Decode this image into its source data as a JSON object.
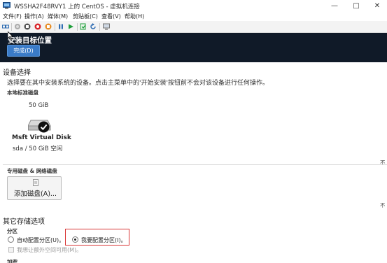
{
  "window": {
    "title": "WSSHA2F48RVY1 上的 CentOS - 虚拟机连接",
    "minimize_glyph": "—",
    "maximize_glyph": "□",
    "close_glyph": "✕"
  },
  "menu": {
    "items": [
      {
        "label": "文件(F)"
      },
      {
        "label": "操作(A)"
      },
      {
        "label": "媒体(M)"
      },
      {
        "label": "剪贴板(C)"
      },
      {
        "label": "查看(V)"
      },
      {
        "label": "帮助(H)"
      }
    ]
  },
  "toolbar": {
    "icons": [
      "ctrl-alt-del-icon",
      "start-icon",
      "turn-off-icon",
      "shut-down-icon",
      "save-icon",
      "pause-icon",
      "resume-icon",
      "checkpoint-icon",
      "revert-icon",
      "enhanced-session-icon"
    ]
  },
  "header": {
    "title": "安装目标位置",
    "done_label": "完成(D)",
    "background": "#101a28",
    "accent": "#3a7bc8"
  },
  "device_selection": {
    "heading": "设备选择",
    "description": "选择要在其中安装系统的设备。点击主菜单中的'开始安装'按钮前不会对该设备进行任何操作。",
    "local_disks_heading": "本地标准磁盘",
    "disk": {
      "size": "50 GiB",
      "name": "Msft Virtual Disk",
      "details": "sda  /  50 GiB 空闲",
      "selected": true
    },
    "right_note": "不",
    "specialized_heading": "专用磁盘 & 网络磁盘",
    "add_disk_label": "添加磁盘(A)...",
    "right_note_2": "不"
  },
  "storage_options": {
    "heading": "其它存储选项",
    "partition_heading": "分区",
    "auto_label": "自动配置分区(U)。",
    "manual_label": "我要配置分区(I)。",
    "selected": "manual",
    "extra_space_label": "我想让额外空间可用(M)。",
    "encryption_heading": "加密"
  }
}
